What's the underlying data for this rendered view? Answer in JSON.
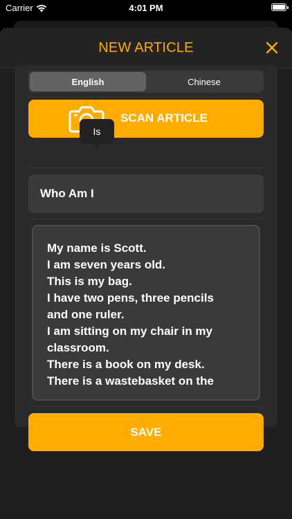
{
  "status_bar": {
    "carrier": "Carrier",
    "time": "4:01 PM"
  },
  "nav": {
    "title": "NEW ARTICLE",
    "close_icon": "close-icon"
  },
  "language_selector": {
    "options": [
      "English",
      "Chinese"
    ],
    "selected": "English"
  },
  "scan": {
    "label": "SCAN ARTICLE",
    "icon": "camera-icon"
  },
  "tooltip": {
    "text": "Is"
  },
  "article": {
    "title": "Who Am I",
    "body_lines": [
      "My name is Scott.",
      "I am seven years old.",
      "This is my bag.",
      "I have two pens, three pencils",
      "and one ruler.",
      "I am sitting on my chair in my",
      "classroom.",
      "There is a book on my desk.",
      "There is a wastebasket on the"
    ]
  },
  "save": {
    "label": "SAVE"
  },
  "colors": {
    "accent": "#ffab00",
    "background": "#000000",
    "card": "#2a2a2c",
    "field": "#3a3a3c"
  }
}
